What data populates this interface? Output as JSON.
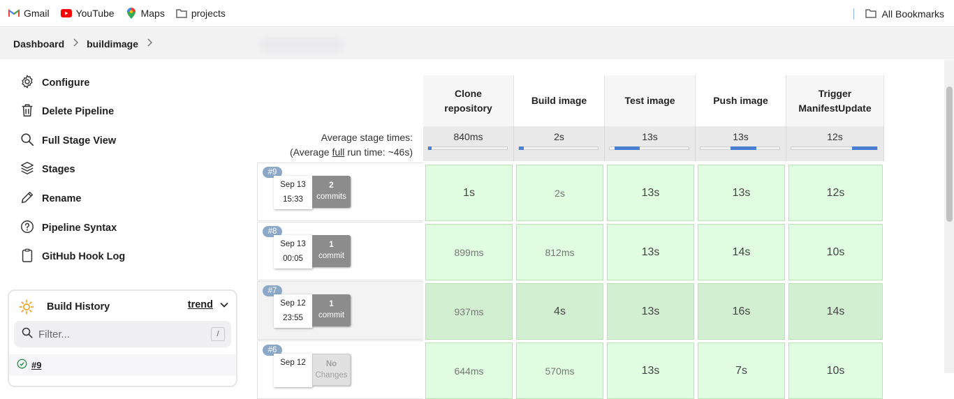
{
  "bookmarks": {
    "items": [
      {
        "label": "Gmail",
        "icon": "gmail-icon"
      },
      {
        "label": "YouTube",
        "icon": "youtube-icon"
      },
      {
        "label": "Maps",
        "icon": "maps-icon"
      },
      {
        "label": "projects",
        "icon": "folder-icon"
      }
    ],
    "all_label": "All Bookmarks"
  },
  "breadcrumb": {
    "items": [
      "Dashboard",
      "buildimage"
    ]
  },
  "sidebar": {
    "items": [
      {
        "label": "Configure",
        "icon": "gear-icon"
      },
      {
        "label": "Delete Pipeline",
        "icon": "trash-icon"
      },
      {
        "label": "Full Stage View",
        "icon": "search-icon"
      },
      {
        "label": "Stages",
        "icon": "layers-icon"
      },
      {
        "label": "Rename",
        "icon": "pencil-icon"
      },
      {
        "label": "Pipeline Syntax",
        "icon": "help-icon"
      },
      {
        "label": "GitHub Hook Log",
        "icon": "clipboard-icon"
      }
    ]
  },
  "build_history": {
    "title": "Build History",
    "trend_label": "trend",
    "filter_placeholder": "Filter...",
    "filter_shortcut": "/",
    "rows": [
      {
        "label": "#9",
        "status": "success"
      }
    ]
  },
  "stage_view": {
    "stages": [
      {
        "name_line1": "Clone",
        "name_line2": "repository",
        "avg": "840ms",
        "fill_start": 0.0,
        "fill_width": 0.02
      },
      {
        "name_line1": "Build image",
        "name_line2": "",
        "avg": "2s",
        "fill_start": 0.0,
        "fill_width": 0.06
      },
      {
        "name_line1": "Test image",
        "name_line2": "",
        "avg": "13s",
        "fill_start": 0.06,
        "fill_width": 0.32
      },
      {
        "name_line1": "Push image",
        "name_line2": "",
        "avg": "13s",
        "fill_start": 0.38,
        "fill_width": 0.33
      },
      {
        "name_line1": "Trigger",
        "name_line2": "ManifestUpdate",
        "avg": "12s",
        "fill_start": 0.71,
        "fill_width": 0.29
      }
    ],
    "avg_label_line1": "Average stage times:",
    "avg_label_line2_prefix": "(Average ",
    "avg_label_line2_link": "full",
    "avg_label_line2_suffix": " run time: ~46s)",
    "runs": [
      {
        "id": "#9",
        "date": "Sep 13",
        "time": "15:33",
        "commits_count": "2",
        "commits_label": "commits",
        "durations": [
          "1s",
          "2s",
          "13s",
          "13s",
          "12s"
        ]
      },
      {
        "id": "#8",
        "date": "Sep 13",
        "time": "00:05",
        "commits_count": "1",
        "commits_label": "commit",
        "durations": [
          "899ms",
          "812ms",
          "13s",
          "14s",
          "10s"
        ]
      },
      {
        "id": "#7",
        "date": "Sep 12",
        "time": "23:55",
        "commits_count": "1",
        "commits_label": "commit",
        "durations": [
          "937ms",
          "4s",
          "13s",
          "16s",
          "14s"
        ]
      },
      {
        "id": "#6",
        "date": "Sep 12",
        "time": "",
        "commits_count": "No",
        "commits_label": "Changes",
        "durations": [
          "644ms",
          "570ms",
          "13s",
          "7s",
          "10s"
        ]
      }
    ]
  },
  "colors": {
    "success_cell": "#e1fde1",
    "success_border": "#b7e5b2",
    "bar_fill": "#4a7fd4",
    "badge": "#8ca8c9"
  }
}
